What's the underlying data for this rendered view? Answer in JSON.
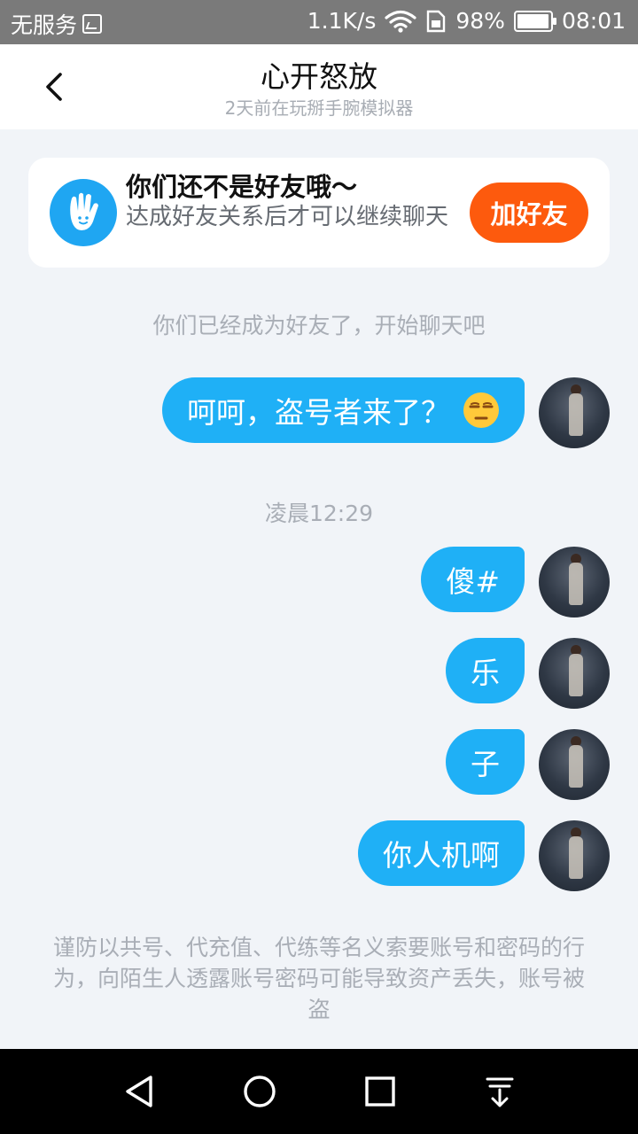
{
  "status_bar": {
    "carrier": "无服务",
    "speed": "1.1K/s",
    "battery": "98%",
    "battery_level": 0.98,
    "time": "08:01"
  },
  "header": {
    "title": "心开怒放",
    "subtitle": "2天前在玩掰手腕模拟器"
  },
  "friend_card": {
    "title": "你们还不是好友哦～",
    "description": "达成好友关系后才可以继续聊天",
    "add_button": "加好友"
  },
  "system": {
    "became_friends": "你们已经成为好友了，开始聊天吧",
    "timestamp": "凌晨12:29",
    "warning": "谨防以共号、代充值、代练等名义索要账号和密码的行为，向陌生人透露账号密码可能导致资产丢失，账号被盗"
  },
  "messages": [
    {
      "text": "呵呵，盗号者来了？"
    },
    {
      "text": "傻#"
    },
    {
      "text": "乐"
    },
    {
      "text": "子"
    },
    {
      "text": "你人机啊"
    }
  ],
  "colors": {
    "bubble": "#1fb0f6",
    "add_button": "#fd5a0d",
    "background": "#f1f4f8"
  },
  "icons": {
    "back": "chevron-left-icon",
    "emoji": "unamused-face-icon",
    "card": "hand-wave-icon"
  }
}
